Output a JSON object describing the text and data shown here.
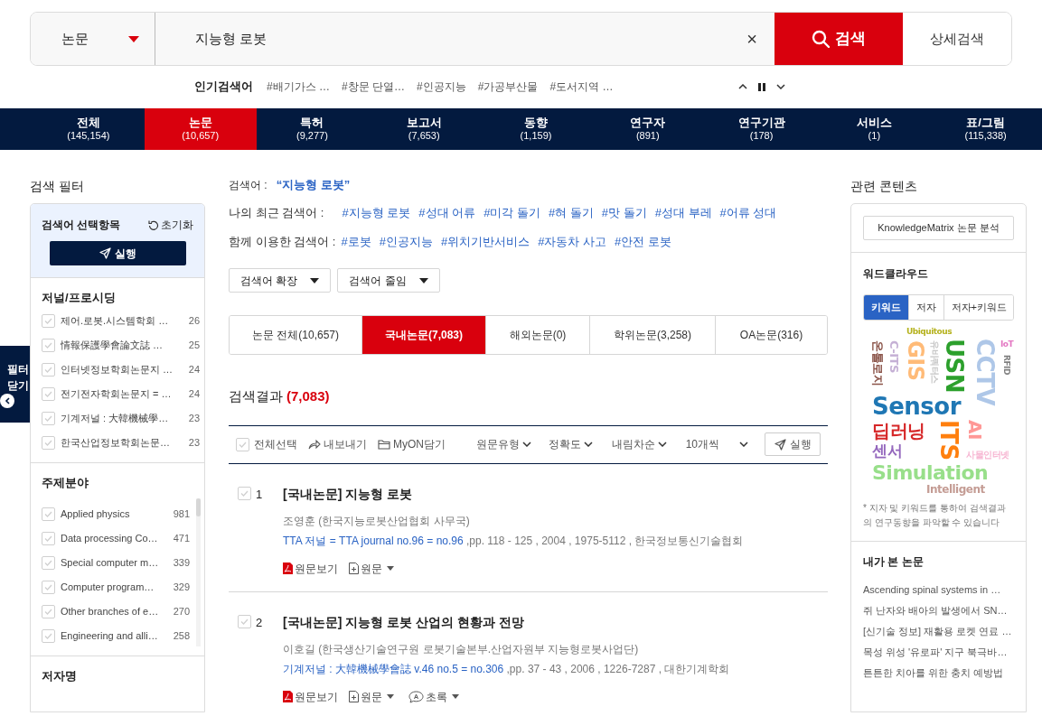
{
  "search": {
    "category": "논문",
    "query": "지능형 로봇",
    "clear": "×",
    "button": "검색",
    "advanced": "상세검색"
  },
  "popular": {
    "label": "인기검색어",
    "terms": [
      "#배기가스 …",
      "#창문 단열…",
      "#인공지능",
      "#가공부산물",
      "#도서지역 …"
    ]
  },
  "nav": [
    {
      "label": "전체",
      "count": "(145,154)",
      "selected": false
    },
    {
      "label": "논문",
      "count": "(10,657)",
      "selected": true
    },
    {
      "label": "특허",
      "count": "(9,277)",
      "selected": false
    },
    {
      "label": "보고서",
      "count": "(7,653)",
      "selected": false
    },
    {
      "label": "동향",
      "count": "(1,159)",
      "selected": false
    },
    {
      "label": "연구자",
      "count": "(891)",
      "selected": false
    },
    {
      "label": "연구기관",
      "count": "(178)",
      "selected": false
    },
    {
      "label": "서비스",
      "count": "(1)",
      "selected": false
    },
    {
      "label": "표/그림",
      "count": "(115,338)",
      "selected": false
    }
  ],
  "filter": {
    "title": "검색 필터",
    "toggle": [
      "필터",
      "닫기"
    ],
    "selection": {
      "title": "검색어 선택항목",
      "reset": "초기화",
      "run": "실행"
    },
    "groups": [
      {
        "title": "저널/프로시딩",
        "items": [
          {
            "label": "제어.로봇.시스템학회 …",
            "count": "26",
            "checked": false
          },
          {
            "label": "情報保護學會論文誌 …",
            "count": "25",
            "checked": false
          },
          {
            "label": "인터넷정보학회논문지 …",
            "count": "24",
            "checked": false
          },
          {
            "label": "전기전자학회논문지 = …",
            "count": "24",
            "checked": false
          },
          {
            "label": "기계저널 : 大韓機械學…",
            "count": "23",
            "checked": false
          },
          {
            "label": "한국산업정보학회논문…",
            "count": "23",
            "checked": false
          }
        ]
      },
      {
        "title": "주제분야",
        "items": [
          {
            "label": "Applied physics",
            "count": "981",
            "checked": false
          },
          {
            "label": "Data processing Co…",
            "count": "471",
            "checked": false
          },
          {
            "label": "Special computer m…",
            "count": "339",
            "checked": false
          },
          {
            "label": "Computer program…",
            "count": "329",
            "checked": false
          },
          {
            "label": "Other branches of e…",
            "count": "270",
            "checked": false
          },
          {
            "label": "Engineering and alli…",
            "count": "258",
            "checked": false
          }
        ]
      },
      {
        "title": "저자명"
      }
    ]
  },
  "query_line": {
    "label": "검색어 :",
    "value": "“지능형 로봇”"
  },
  "recent": {
    "label": "나의 최근 검색어 :",
    "tags": [
      "#지능형 로봇",
      "#성대 어류",
      "#미각 돌기",
      "#혀 돌기",
      "#맛 돌기",
      "#성대 부레",
      "#어류 성대"
    ]
  },
  "related": {
    "label": "함께 이용한 검색어 :",
    "tags": [
      "#로봇",
      "#인공지능",
      "#위치기반서비스",
      "#자동차 사고",
      "#안전 로봇"
    ]
  },
  "dropdowns": [
    "검색어 확장",
    "검색어 줄임"
  ],
  "subtabs": [
    {
      "label": "논문 전체(10,657)",
      "selected": false
    },
    {
      "label": "국내논문(7,083)",
      "selected": true
    },
    {
      "label": "해외논문(0)",
      "selected": false
    },
    {
      "label": "학위논문(3,258)",
      "selected": false
    },
    {
      "label": "OA논문(316)",
      "selected": false
    }
  ],
  "result_header": {
    "title": "검색결과",
    "count": "(7,083)"
  },
  "toolbar": {
    "select_all": "전체선택",
    "select_all_checked": false,
    "export": "내보내기",
    "myon": "MyON담기",
    "sorts": [
      "원문유형",
      "정확도",
      "내림차순",
      "10개씩"
    ],
    "run": "실행"
  },
  "results": [
    {
      "number": "1",
      "checked": false,
      "title": "[국내논문] 지능형 로봇",
      "authors": "조영훈 (한국지능로봇산업협회 사무국)",
      "source_link": "TTA 저널 = TTA journal no.96 = no.96",
      "source_rest": " ,pp. 118 - 125 , 2004 , 1975-5112 , 한국정보통신기술협회",
      "actions": [
        {
          "kind": "pdf",
          "label": "원문보기"
        },
        {
          "kind": "file",
          "label": "원문"
        }
      ]
    },
    {
      "number": "2",
      "checked": false,
      "title": "[국내논문] 지능형 로봇 산업의 현황과 전망",
      "authors": "이호길 (한국생산기술연구원 로봇기술본부.산업자원부 지능형로봇사업단)",
      "source_link": "기계저널 : 大韓機械學會誌 v.46 no.5 = no.306",
      "source_rest": " ,pp. 37 - 43 , 2006 , 1226-7287 , 대한기계학회",
      "actions": [
        {
          "kind": "pdf",
          "label": "원문보기"
        },
        {
          "kind": "file",
          "label": "원문"
        },
        {
          "kind": "abstract",
          "label": "초록"
        }
      ]
    }
  ],
  "related_content": {
    "title": "관련 콘텐츠",
    "km_button": "KnowledgeMatrix 논문 분석",
    "wordcloud": {
      "title": "워드클라우드",
      "tabs": [
        {
          "label": "키워드",
          "selected": true
        },
        {
          "label": "저자",
          "selected": false
        },
        {
          "label": "저자+키워드",
          "selected": false
        }
      ],
      "words": [
        {
          "text": "Ubiquitous",
          "color": "#b5b21e",
          "vertical": false
        },
        {
          "text": "C-ITS",
          "color": "#c5b0d5",
          "vertical": true
        },
        {
          "text": "GIS",
          "color": "#ffbb78",
          "vertical": true
        },
        {
          "text": "유비쿼터스",
          "color": "#c7c7c7",
          "vertical": true
        },
        {
          "text": "USN",
          "color": "#2ca02c",
          "vertical": true
        },
        {
          "text": "CCTV",
          "color": "#aec7e8",
          "vertical": true
        },
        {
          "text": "온톨로지",
          "color": "#8c564b",
          "vertical": true
        },
        {
          "text": "Sensor",
          "color": "#1f77b4",
          "vertical": false
        },
        {
          "text": "IoT",
          "color": "#e377c2",
          "vertical": false
        },
        {
          "text": "딥러닝",
          "color": "#d62728",
          "vertical": false
        },
        {
          "text": "ITS",
          "color": "#ff7f0e",
          "vertical": true
        },
        {
          "text": "사물인터넷",
          "color": "#f7b6d2",
          "vertical": false
        },
        {
          "text": "AI",
          "color": "#ff9896",
          "vertical": true
        },
        {
          "text": "RFID",
          "color": "#7f7f7f",
          "vertical": true
        },
        {
          "text": "센서",
          "color": "#9467bd",
          "vertical": false
        },
        {
          "text": "Simulation",
          "color": "#98df8a",
          "vertical": false
        },
        {
          "text": "Intelligent",
          "color": "#c49c94",
          "vertical": false
        }
      ],
      "note": "* 지자 및 키워드를 통하여 검색결과의 연구동향을 파악할 수 있습니다"
    },
    "viewed": {
      "title": "내가 본 논문",
      "items": [
        "Ascending spinal systems in …",
        "쥐 난자와 배아의 발생에서 SN…",
        "[신기술 정보] 재활용 로켓 연료 …",
        "목성 위성 '유로파' 지구 북극바…",
        "튼튼한 치아를 위한 충치 예방법"
      ]
    }
  }
}
